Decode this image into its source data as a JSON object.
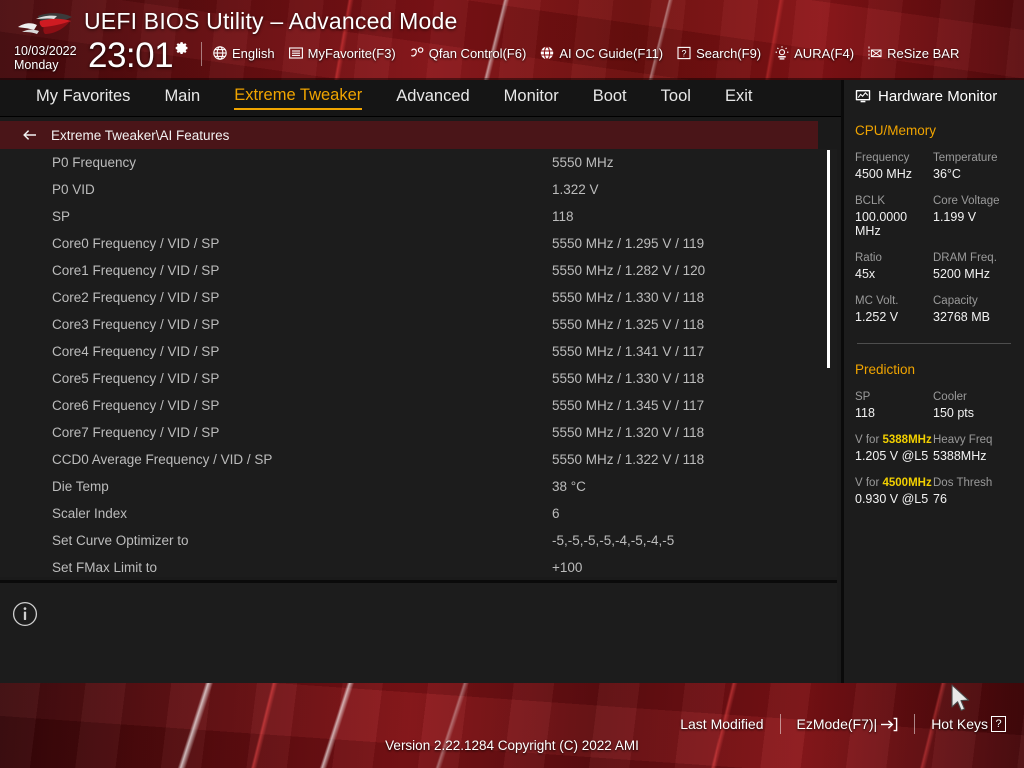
{
  "header": {
    "logo": "rog-logo",
    "title": "UEFI BIOS Utility – Advanced Mode",
    "date": "10/03/2022",
    "weekday": "Monday",
    "time": "23:01",
    "gear_icon": "gear-icon",
    "toolbar": [
      {
        "label": "English",
        "icon": "globe-icon"
      },
      {
        "label": "MyFavorite(F3)",
        "icon": "list-icon"
      },
      {
        "label": "Qfan Control(F6)",
        "icon": "fan-icon"
      },
      {
        "label": "AI OC Guide(F11)",
        "icon": "ai-globe-icon"
      },
      {
        "label": "Search(F9)",
        "icon": "question-box-icon"
      },
      {
        "label": "AURA(F4)",
        "icon": "aura-light-icon"
      },
      {
        "label": "ReSize BAR",
        "icon": "resize-bar-icon"
      }
    ]
  },
  "nav": {
    "tabs": [
      {
        "label": "My Favorites",
        "active": false
      },
      {
        "label": "Main",
        "active": false
      },
      {
        "label": "Extreme Tweaker",
        "active": true
      },
      {
        "label": "Advanced",
        "active": false
      },
      {
        "label": "Monitor",
        "active": false
      },
      {
        "label": "Boot",
        "active": false
      },
      {
        "label": "Tool",
        "active": false
      },
      {
        "label": "Exit",
        "active": false
      }
    ],
    "active_color": "#f0a400"
  },
  "breadcrumb": {
    "back_icon": "arrow-left-icon",
    "path": "Extreme Tweaker\\AI Features"
  },
  "main": {
    "rows": [
      {
        "label": "P0 Frequency",
        "value": "5550 MHz"
      },
      {
        "label": "P0 VID",
        "value": "1.322 V"
      },
      {
        "label": "SP",
        "value": "118"
      },
      {
        "label": "Core0 Frequency / VID / SP",
        "value": "5550 MHz / 1.295 V / 119"
      },
      {
        "label": "Core1 Frequency / VID / SP",
        "value": "5550 MHz / 1.282 V / 120"
      },
      {
        "label": "Core2 Frequency / VID / SP",
        "value": "5550 MHz / 1.330 V / 118"
      },
      {
        "label": "Core3 Frequency / VID / SP",
        "value": "5550 MHz / 1.325 V / 118"
      },
      {
        "label": "Core4 Frequency / VID / SP",
        "value": "5550 MHz / 1.341 V / 117"
      },
      {
        "label": "Core5 Frequency / VID / SP",
        "value": "5550 MHz / 1.330 V / 118"
      },
      {
        "label": "Core6 Frequency / VID / SP",
        "value": "5550 MHz / 1.345 V / 117"
      },
      {
        "label": "Core7 Frequency / VID / SP",
        "value": "5550 MHz / 1.320 V / 118"
      },
      {
        "label": "CCD0 Average Frequency / VID / SP",
        "value": "5550 MHz / 1.322 V / 118"
      },
      {
        "label": "Die Temp",
        "value": "38 °C"
      },
      {
        "label": "Scaler Index",
        "value": "6"
      },
      {
        "label": "Set Curve Optimizer to",
        "value": "-5,-5,-5,-5,-4,-5,-4,-5"
      },
      {
        "label": "Set FMax Limit to",
        "value": "+100"
      }
    ],
    "scrollbar": {
      "visible": true
    }
  },
  "help": {
    "info_icon": "info-circle-icon"
  },
  "hwmon": {
    "title": "Hardware Monitor",
    "title_icon": "monitor-icon",
    "sections": [
      {
        "name": "CPU/Memory",
        "pairs": [
          {
            "k1": "Frequency",
            "v1": "4500 MHz",
            "k2": "Temperature",
            "v2": "36°C"
          },
          {
            "k1": "BCLK",
            "v1": "100.0000 MHz",
            "k2": "Core Voltage",
            "v2": "1.199 V"
          },
          {
            "k1": "Ratio",
            "v1": "45x",
            "k2": "DRAM Freq.",
            "v2": "5200 MHz"
          },
          {
            "k1": "MC Volt.",
            "v1": "1.252 V",
            "k2": "Capacity",
            "v2": "32768 MB"
          }
        ]
      },
      {
        "name": "Prediction",
        "pairs": [
          {
            "k1": "SP",
            "v1": "118",
            "k2": "Cooler",
            "v2": "150 pts"
          },
          {
            "k1": "V for ",
            "k1_em": "5388MHz",
            "v1": "1.205 V @L5",
            "k2": "Heavy Freq",
            "v2": "5388MHz"
          },
          {
            "k1": "V for ",
            "k1_em": "4500MHz",
            "v1": "0.930 V @L5",
            "k2": "Dos Thresh",
            "v2": "76"
          }
        ]
      }
    ]
  },
  "footer": {
    "actions": [
      {
        "label": "Last Modified",
        "icon": ""
      },
      {
        "label": "EzMode(F7)|",
        "icon": "exit-arrow-icon"
      },
      {
        "label": "Hot Keys",
        "icon": "question-box-icon"
      }
    ],
    "version": "Version 2.22.1284 Copyright (C) 2022 AMI"
  },
  "colors": {
    "accent_amber": "#f0a400",
    "brand_red": "#8c1418",
    "panel_bg": "#1c1c1c",
    "nav_bg": "#151515",
    "breadcrumb_bg": "#4a1518",
    "highlight_yellow": "#f2d000"
  }
}
